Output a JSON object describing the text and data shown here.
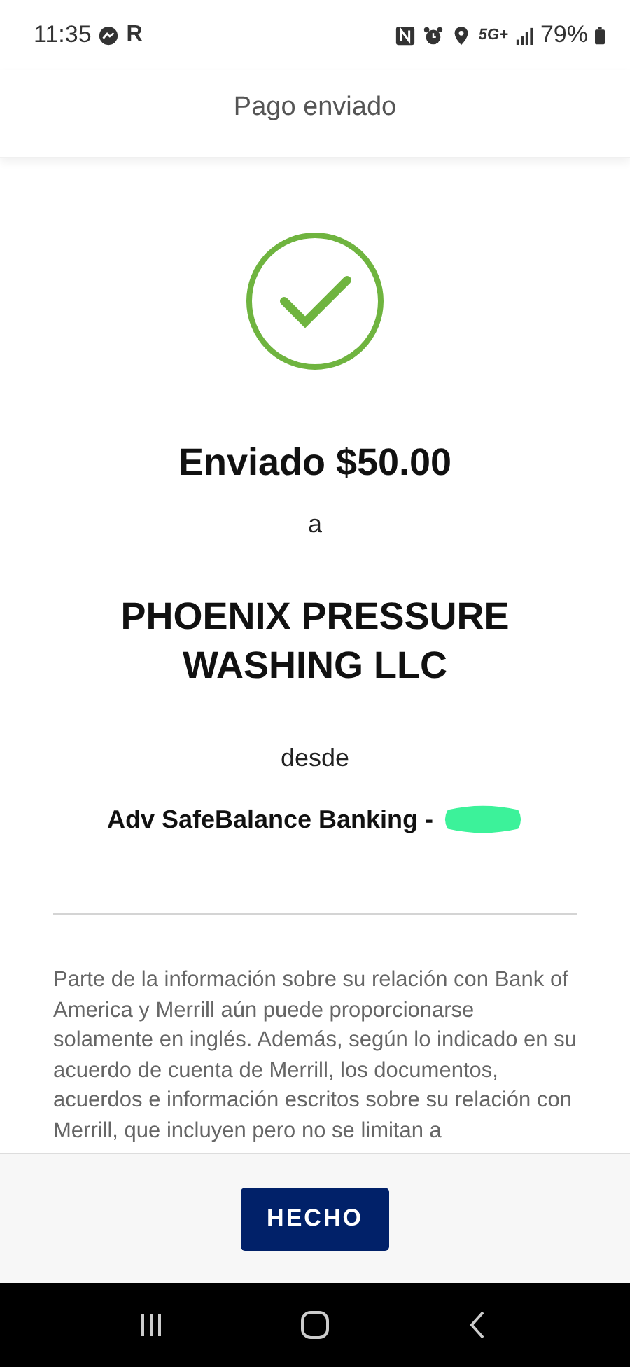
{
  "status_bar": {
    "time": "11:35",
    "app_letter": "R",
    "network": "5G+",
    "battery": "79%"
  },
  "header": {
    "title": "Pago enviado"
  },
  "confirmation": {
    "amount_line": "Enviado $50.00",
    "to_word": "a",
    "payee": "PHOENIX PRESSURE WASHING LLC",
    "from_word": "desde",
    "account": "Adv SafeBalance Banking -",
    "account_redacted": true
  },
  "disclosure": "Parte de la información sobre su relación con Bank of America y Merrill aún puede proporcionarse solamente en inglés. Además, según lo indicado en su acuerdo de cuenta de Merrill, los documentos, acuerdos e información escritos sobre su relación con Merrill, que incluyen pero no se limitan a",
  "footer": {
    "button": "HECHO"
  }
}
